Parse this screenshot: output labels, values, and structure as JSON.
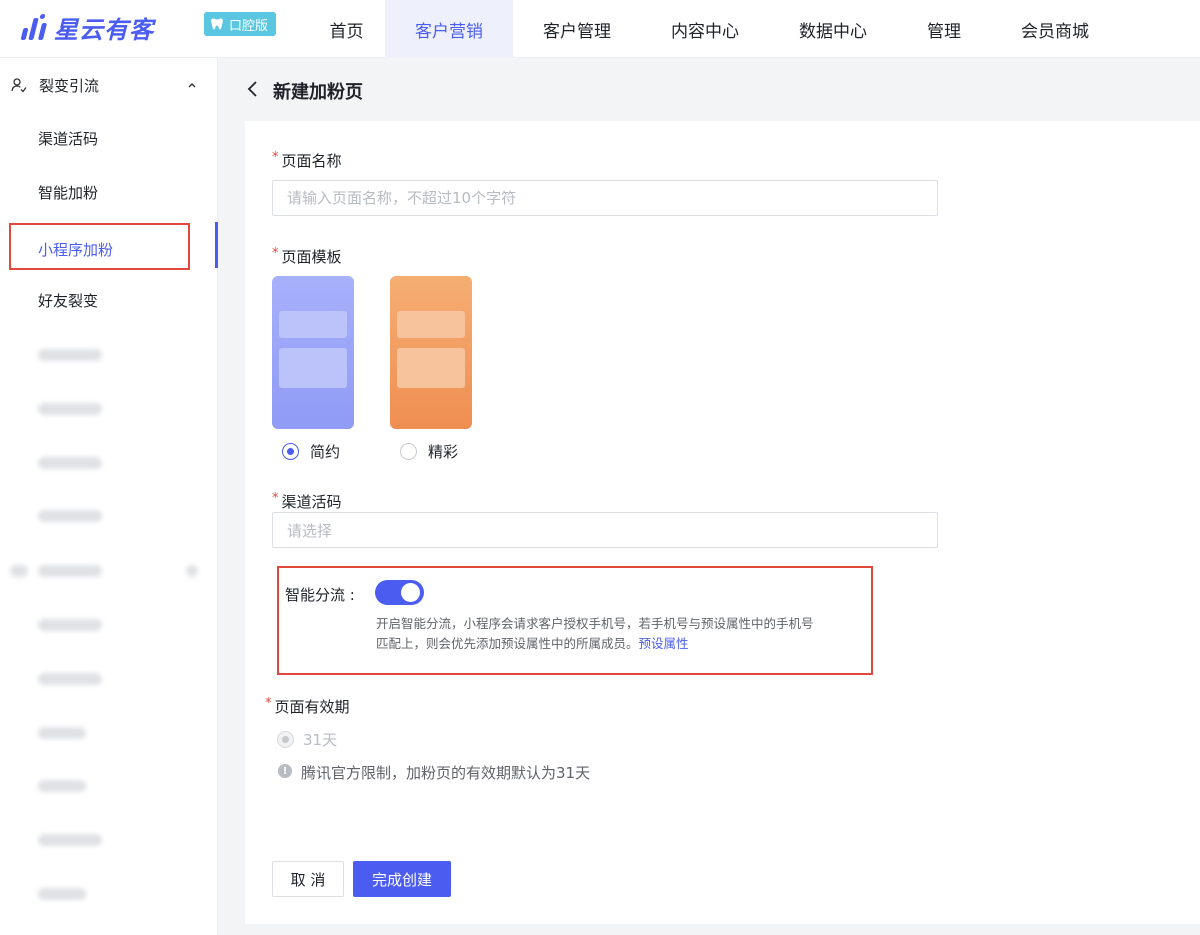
{
  "header": {
    "brand": "星云有客",
    "edition": "口腔版",
    "nav": [
      {
        "label": "首页"
      },
      {
        "label": "客户营销"
      },
      {
        "label": "客户管理"
      },
      {
        "label": "内容中心"
      },
      {
        "label": "数据中心"
      },
      {
        "label": "管理"
      },
      {
        "label": "会员商城"
      }
    ],
    "active_nav": "客户营销"
  },
  "sidebar": {
    "group": "裂变引流",
    "items": [
      {
        "label": "渠道活码"
      },
      {
        "label": "智能加粉"
      },
      {
        "label": "小程序加粉"
      },
      {
        "label": "好友裂变"
      }
    ],
    "active_item": "小程序加粉"
  },
  "page": {
    "title": "新建加粉页"
  },
  "form": {
    "name_label": "页面名称",
    "name_placeholder": "请输入页面名称，不超过10个字符",
    "name_value": "",
    "template_label": "页面模板",
    "templates": [
      {
        "label": "简约",
        "color": "#9aa4f7",
        "selected": true
      },
      {
        "label": "精彩",
        "color": "#f29a5c",
        "selected": false
      }
    ],
    "channel_label": "渠道活码",
    "channel_placeholder": "请选择",
    "smart_split_label": "智能分流 :",
    "smart_split_on": true,
    "smart_split_desc_line1": "开启智能分流，小程序会请求客户授权手机号，若手机号与预设属性中的手机号",
    "smart_split_desc_line2": "匹配上，则会优先添加预设属性中的所属成员。",
    "smart_split_link": "预设属性",
    "validity_label": "页面有效期",
    "validity_option": "31天",
    "validity_hint": "腾讯官方限制，加粉页的有效期默认为31天",
    "cancel_label": "取 消",
    "submit_label": "完成创建"
  },
  "colors": {
    "accent": "#4b5cf0",
    "required": "#e3473b",
    "highlight": "#e3473b"
  }
}
